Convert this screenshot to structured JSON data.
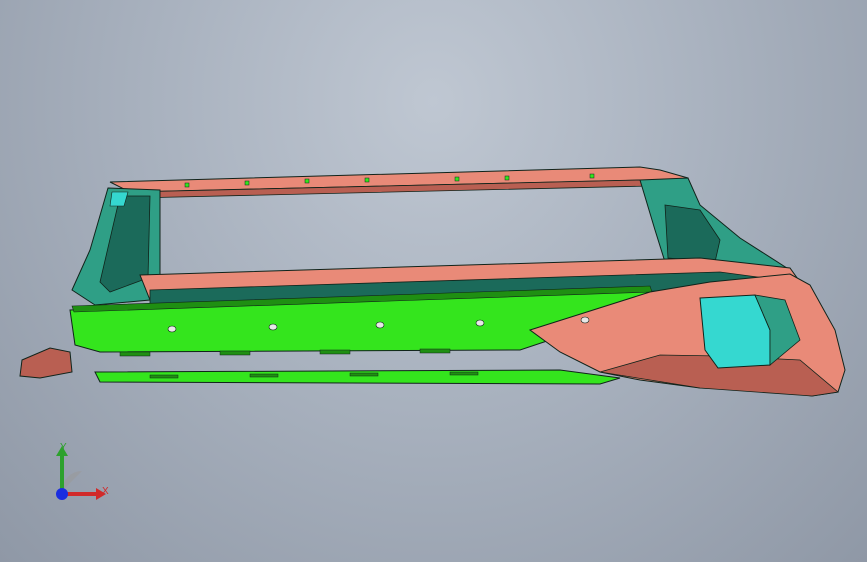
{
  "viewport": {
    "background_top": "#bfc7d2",
    "background_bottom": "#8f98a6"
  },
  "model": {
    "colors": {
      "salmon": "#e98a78",
      "salmon_dark": "#b95f52",
      "green": "#34e51d",
      "green_dark": "#1f8f12",
      "teal": "#2f9f86",
      "teal_dark": "#1b6a5a",
      "cyan": "#35d8d0",
      "edge": "#10231a"
    }
  },
  "triad": {
    "y_label": "Y",
    "x_label": "X",
    "icon": "coordinate-triad-icon"
  }
}
